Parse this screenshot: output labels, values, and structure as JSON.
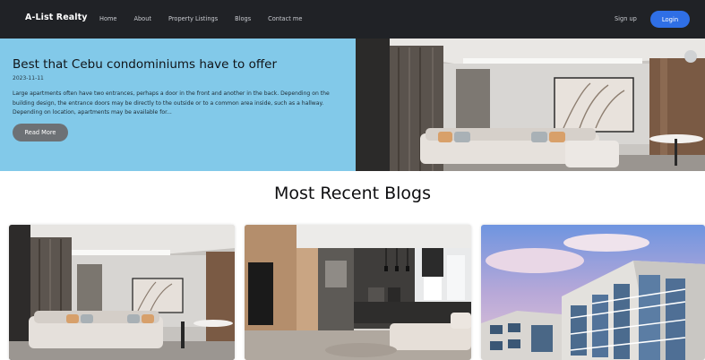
{
  "navbar": {
    "brand": "A-List Realty",
    "links": [
      "Home",
      "About",
      "Property Listings",
      "Blogs",
      "Contact me"
    ],
    "signup_label": "Sign up",
    "login_label": "Login"
  },
  "hero": {
    "title": "Best that Cebu condominiums have to offer",
    "date": "2023-11-11",
    "excerpt": "Large apartments often have two entrances, perhaps a door in the front and another in the back. Depending on the building design, the entrance doors may be directly to the outside or to a common area inside, such as a hallway. Depending on location, apartments may be available for...",
    "read_more_label": "Read More",
    "image_icon": "living-room-photo"
  },
  "recent_blogs": {
    "heading": "Most Recent Blogs",
    "cards": [
      {
        "image_icon": "living-room-photo"
      },
      {
        "image_icon": "kitchen-photo"
      },
      {
        "image_icon": "building-photo"
      }
    ]
  },
  "colors": {
    "navbar_bg": "#202226",
    "hero_bg": "#82c9e9",
    "login_button": "#2f6fe6",
    "read_more_button": "#6d7175"
  }
}
